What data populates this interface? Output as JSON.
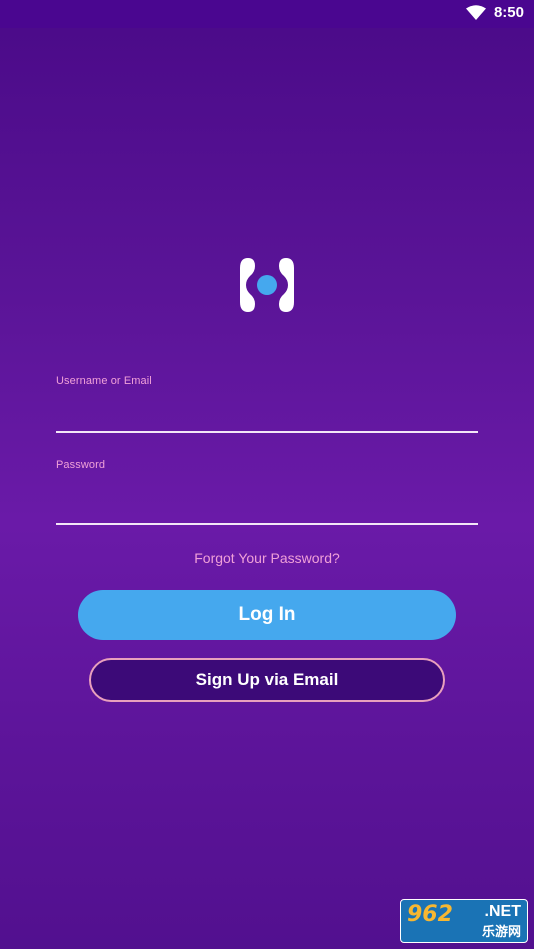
{
  "status_bar": {
    "time": "8:50",
    "wifi_icon": "wifi-icon"
  },
  "logo": {
    "icon": "app-logo-icon",
    "colors": {
      "bracket": "#ffffff",
      "dot": "#45a8ee"
    }
  },
  "form": {
    "username_label": "Username or Email",
    "username_value": "",
    "password_label": "Password",
    "password_value": "",
    "forgot_password": "Forgot Your Password?",
    "login_button": "Log In",
    "signup_button": "Sign Up via Email"
  },
  "watermark": {
    "number": "962",
    "domain": ".NET",
    "chinese": "乐游网"
  },
  "colors": {
    "background": "#5a1497",
    "accent_blue": "#45a8ee",
    "label_pink": "#f0a0d8",
    "signup_fill": "#3c0a78",
    "signup_border": "#e9a0bd"
  }
}
